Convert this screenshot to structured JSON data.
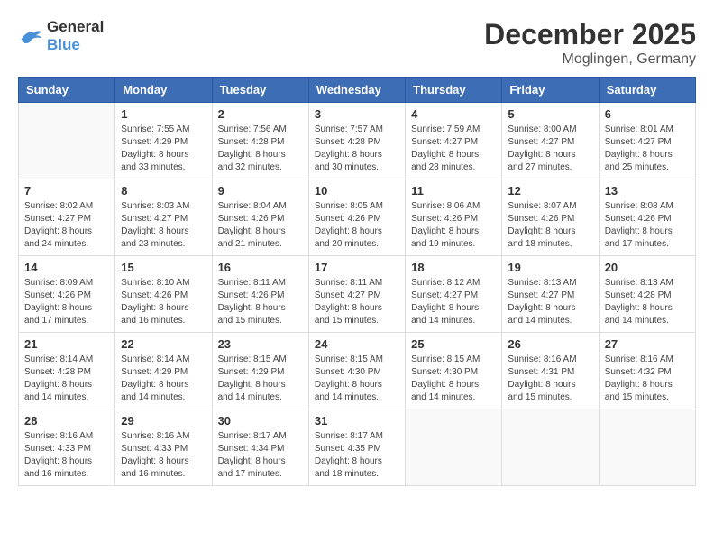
{
  "logo": {
    "line1": "General",
    "line2": "Blue"
  },
  "title": "December 2025",
  "location": "Moglingen, Germany",
  "weekdays": [
    "Sunday",
    "Monday",
    "Tuesday",
    "Wednesday",
    "Thursday",
    "Friday",
    "Saturday"
  ],
  "weeks": [
    [
      {
        "day": "",
        "sunrise": "",
        "sunset": "",
        "daylight": ""
      },
      {
        "day": "1",
        "sunrise": "Sunrise: 7:55 AM",
        "sunset": "Sunset: 4:29 PM",
        "daylight": "Daylight: 8 hours and 33 minutes."
      },
      {
        "day": "2",
        "sunrise": "Sunrise: 7:56 AM",
        "sunset": "Sunset: 4:28 PM",
        "daylight": "Daylight: 8 hours and 32 minutes."
      },
      {
        "day": "3",
        "sunrise": "Sunrise: 7:57 AM",
        "sunset": "Sunset: 4:28 PM",
        "daylight": "Daylight: 8 hours and 30 minutes."
      },
      {
        "day": "4",
        "sunrise": "Sunrise: 7:59 AM",
        "sunset": "Sunset: 4:27 PM",
        "daylight": "Daylight: 8 hours and 28 minutes."
      },
      {
        "day": "5",
        "sunrise": "Sunrise: 8:00 AM",
        "sunset": "Sunset: 4:27 PM",
        "daylight": "Daylight: 8 hours and 27 minutes."
      },
      {
        "day": "6",
        "sunrise": "Sunrise: 8:01 AM",
        "sunset": "Sunset: 4:27 PM",
        "daylight": "Daylight: 8 hours and 25 minutes."
      }
    ],
    [
      {
        "day": "7",
        "sunrise": "Sunrise: 8:02 AM",
        "sunset": "Sunset: 4:27 PM",
        "daylight": "Daylight: 8 hours and 24 minutes."
      },
      {
        "day": "8",
        "sunrise": "Sunrise: 8:03 AM",
        "sunset": "Sunset: 4:27 PM",
        "daylight": "Daylight: 8 hours and 23 minutes."
      },
      {
        "day": "9",
        "sunrise": "Sunrise: 8:04 AM",
        "sunset": "Sunset: 4:26 PM",
        "daylight": "Daylight: 8 hours and 21 minutes."
      },
      {
        "day": "10",
        "sunrise": "Sunrise: 8:05 AM",
        "sunset": "Sunset: 4:26 PM",
        "daylight": "Daylight: 8 hours and 20 minutes."
      },
      {
        "day": "11",
        "sunrise": "Sunrise: 8:06 AM",
        "sunset": "Sunset: 4:26 PM",
        "daylight": "Daylight: 8 hours and 19 minutes."
      },
      {
        "day": "12",
        "sunrise": "Sunrise: 8:07 AM",
        "sunset": "Sunset: 4:26 PM",
        "daylight": "Daylight: 8 hours and 18 minutes."
      },
      {
        "day": "13",
        "sunrise": "Sunrise: 8:08 AM",
        "sunset": "Sunset: 4:26 PM",
        "daylight": "Daylight: 8 hours and 17 minutes."
      }
    ],
    [
      {
        "day": "14",
        "sunrise": "Sunrise: 8:09 AM",
        "sunset": "Sunset: 4:26 PM",
        "daylight": "Daylight: 8 hours and 17 minutes."
      },
      {
        "day": "15",
        "sunrise": "Sunrise: 8:10 AM",
        "sunset": "Sunset: 4:26 PM",
        "daylight": "Daylight: 8 hours and 16 minutes."
      },
      {
        "day": "16",
        "sunrise": "Sunrise: 8:11 AM",
        "sunset": "Sunset: 4:26 PM",
        "daylight": "Daylight: 8 hours and 15 minutes."
      },
      {
        "day": "17",
        "sunrise": "Sunrise: 8:11 AM",
        "sunset": "Sunset: 4:27 PM",
        "daylight": "Daylight: 8 hours and 15 minutes."
      },
      {
        "day": "18",
        "sunrise": "Sunrise: 8:12 AM",
        "sunset": "Sunset: 4:27 PM",
        "daylight": "Daylight: 8 hours and 14 minutes."
      },
      {
        "day": "19",
        "sunrise": "Sunrise: 8:13 AM",
        "sunset": "Sunset: 4:27 PM",
        "daylight": "Daylight: 8 hours and 14 minutes."
      },
      {
        "day": "20",
        "sunrise": "Sunrise: 8:13 AM",
        "sunset": "Sunset: 4:28 PM",
        "daylight": "Daylight: 8 hours and 14 minutes."
      }
    ],
    [
      {
        "day": "21",
        "sunrise": "Sunrise: 8:14 AM",
        "sunset": "Sunset: 4:28 PM",
        "daylight": "Daylight: 8 hours and 14 minutes."
      },
      {
        "day": "22",
        "sunrise": "Sunrise: 8:14 AM",
        "sunset": "Sunset: 4:29 PM",
        "daylight": "Daylight: 8 hours and 14 minutes."
      },
      {
        "day": "23",
        "sunrise": "Sunrise: 8:15 AM",
        "sunset": "Sunset: 4:29 PM",
        "daylight": "Daylight: 8 hours and 14 minutes."
      },
      {
        "day": "24",
        "sunrise": "Sunrise: 8:15 AM",
        "sunset": "Sunset: 4:30 PM",
        "daylight": "Daylight: 8 hours and 14 minutes."
      },
      {
        "day": "25",
        "sunrise": "Sunrise: 8:15 AM",
        "sunset": "Sunset: 4:30 PM",
        "daylight": "Daylight: 8 hours and 14 minutes."
      },
      {
        "day": "26",
        "sunrise": "Sunrise: 8:16 AM",
        "sunset": "Sunset: 4:31 PM",
        "daylight": "Daylight: 8 hours and 15 minutes."
      },
      {
        "day": "27",
        "sunrise": "Sunrise: 8:16 AM",
        "sunset": "Sunset: 4:32 PM",
        "daylight": "Daylight: 8 hours and 15 minutes."
      }
    ],
    [
      {
        "day": "28",
        "sunrise": "Sunrise: 8:16 AM",
        "sunset": "Sunset: 4:33 PM",
        "daylight": "Daylight: 8 hours and 16 minutes."
      },
      {
        "day": "29",
        "sunrise": "Sunrise: 8:16 AM",
        "sunset": "Sunset: 4:33 PM",
        "daylight": "Daylight: 8 hours and 16 minutes."
      },
      {
        "day": "30",
        "sunrise": "Sunrise: 8:17 AM",
        "sunset": "Sunset: 4:34 PM",
        "daylight": "Daylight: 8 hours and 17 minutes."
      },
      {
        "day": "31",
        "sunrise": "Sunrise: 8:17 AM",
        "sunset": "Sunset: 4:35 PM",
        "daylight": "Daylight: 8 hours and 18 minutes."
      },
      {
        "day": "",
        "sunrise": "",
        "sunset": "",
        "daylight": ""
      },
      {
        "day": "",
        "sunrise": "",
        "sunset": "",
        "daylight": ""
      },
      {
        "day": "",
        "sunrise": "",
        "sunset": "",
        "daylight": ""
      }
    ]
  ]
}
